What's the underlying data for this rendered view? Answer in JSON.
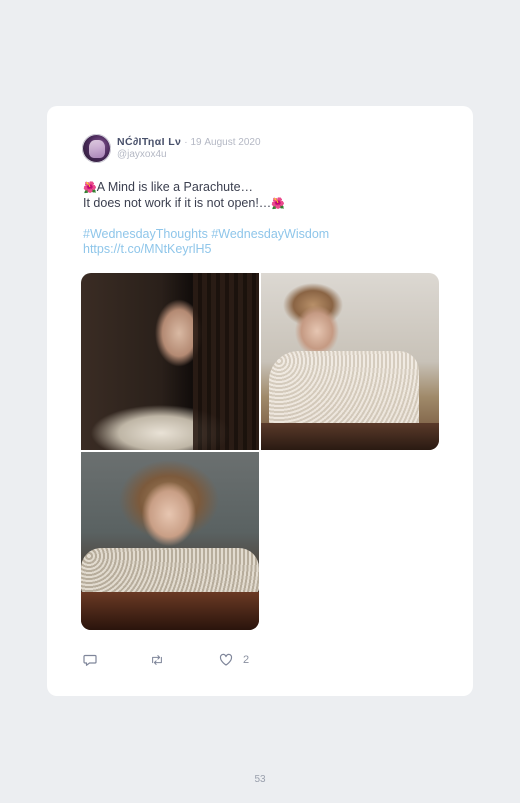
{
  "post": {
    "author_name": "NĆ∂ΙΤηαΙ Lν",
    "separator": "·",
    "date": "19 August 2020",
    "handle": "@jayxox4u",
    "line1_icon": "🌺",
    "line1": "A Mind is like a Parachute…",
    "line2": "It does not work if it is not open!…",
    "line2_icon": "🌺",
    "hashtags": "#WednesdayThoughts #WednesdayWisdom",
    "link": "https://t.co/MNtKeyrlH5",
    "images": [
      "photo-1",
      "photo-2",
      "photo-3"
    ]
  },
  "actions": {
    "reply_icon": "comment-icon",
    "retweet_icon": "retweet-icon",
    "like_icon": "heart-icon",
    "like_count": "2"
  },
  "page_number": "53",
  "colors": {
    "background": "#eceef1",
    "card": "#ffffff",
    "link": "#8fc6ea",
    "muted": "#b4b8c4"
  }
}
